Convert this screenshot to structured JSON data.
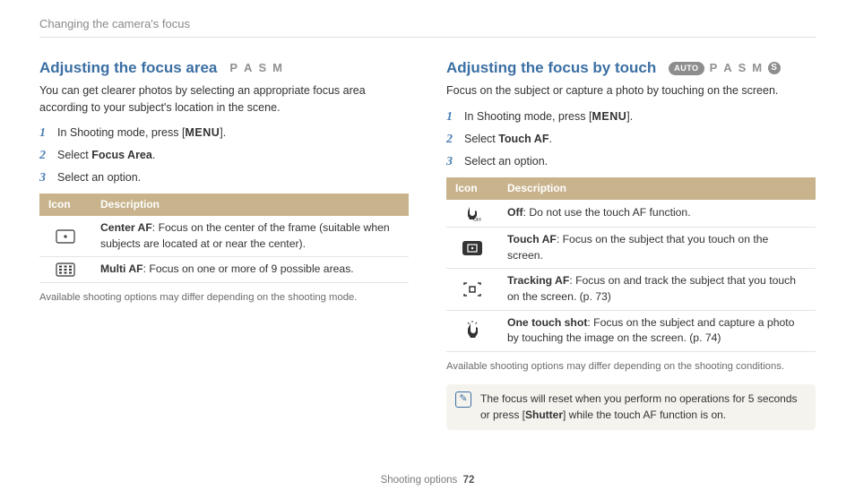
{
  "breadcrumb": "Changing the camera's focus",
  "footer": {
    "section": "Shooting options",
    "page": "72"
  },
  "left": {
    "title": "Adjusting the focus area",
    "modes": [
      "P",
      "A",
      "S",
      "M"
    ],
    "intro": "You can get clearer photos by selecting an appropriate focus area according to your subject's location in the scene.",
    "steps": [
      {
        "n": "1",
        "pre": "In Shooting mode, press [",
        "kw": "MENU",
        "post": "]."
      },
      {
        "n": "2",
        "pre": "Select ",
        "kw": "Focus Area",
        "post": "."
      },
      {
        "n": "3",
        "pre": "Select an option.",
        "kw": "",
        "post": ""
      }
    ],
    "th": {
      "icon": "Icon",
      "desc": "Description"
    },
    "rows": [
      {
        "bold": "Center AF",
        "text": ": Focus on the center of the frame (suitable when subjects are located at or near the center)."
      },
      {
        "bold": "Multi AF",
        "text": ": Focus on one or more of 9 possible areas."
      }
    ],
    "footnote": "Available shooting options may differ depending on the shooting mode."
  },
  "right": {
    "title": "Adjusting the focus by touch",
    "auto_pill": "AUTO",
    "s_pill": "S",
    "modes": [
      "P",
      "A",
      "S",
      "M"
    ],
    "intro": "Focus on the subject or capture a photo by touching on the screen.",
    "steps": [
      {
        "n": "1",
        "pre": "In Shooting mode, press [",
        "kw": "MENU",
        "post": "]."
      },
      {
        "n": "2",
        "pre": "Select ",
        "kw": "Touch AF",
        "post": "."
      },
      {
        "n": "3",
        "pre": "Select an option.",
        "kw": "",
        "post": ""
      }
    ],
    "th": {
      "icon": "Icon",
      "desc": "Description"
    },
    "rows": [
      {
        "bold": "Off",
        "text": ": Do not use the touch AF function."
      },
      {
        "bold": "Touch AF",
        "text": ": Focus on the subject that you touch on the screen."
      },
      {
        "bold": "Tracking AF",
        "text": ": Focus on and track the subject that you touch on the screen. (p. 73)"
      },
      {
        "bold": "One touch shot",
        "text": ": Focus on the subject and capture a photo by touching the image on the screen. (p. 74)"
      }
    ],
    "footnote": "Available shooting options may differ depending on the shooting conditions.",
    "note_pre": "The focus will reset when you perform no operations for 5 seconds or press [",
    "note_kw": "Shutter",
    "note_post": "] while the touch AF function is on."
  }
}
